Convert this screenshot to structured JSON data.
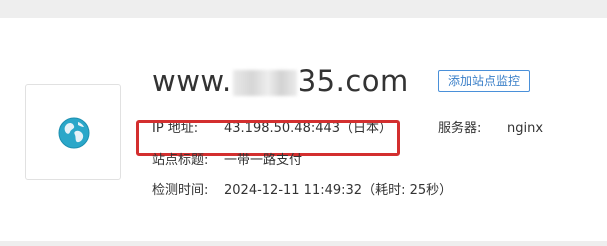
{
  "site": {
    "domain_prefix": "www.",
    "domain_suffix": "35.com",
    "add_monitor_label": "添加站点监控"
  },
  "info": {
    "ip_label": "IP 地址:",
    "ip_value": "43.198.50.48:443（日本）",
    "server_label": "服务器:",
    "server_value": "nginx",
    "title_label": "站点标题:",
    "title_value": "一带一路支付",
    "check_label": "检测时间:",
    "check_value": "2024-12-11 11:49:32（耗时: 25秒）"
  },
  "colors": {
    "highlight": "#d32f2f",
    "accent": "#3a7fc8",
    "globe_sea": "#2aa7c9"
  }
}
